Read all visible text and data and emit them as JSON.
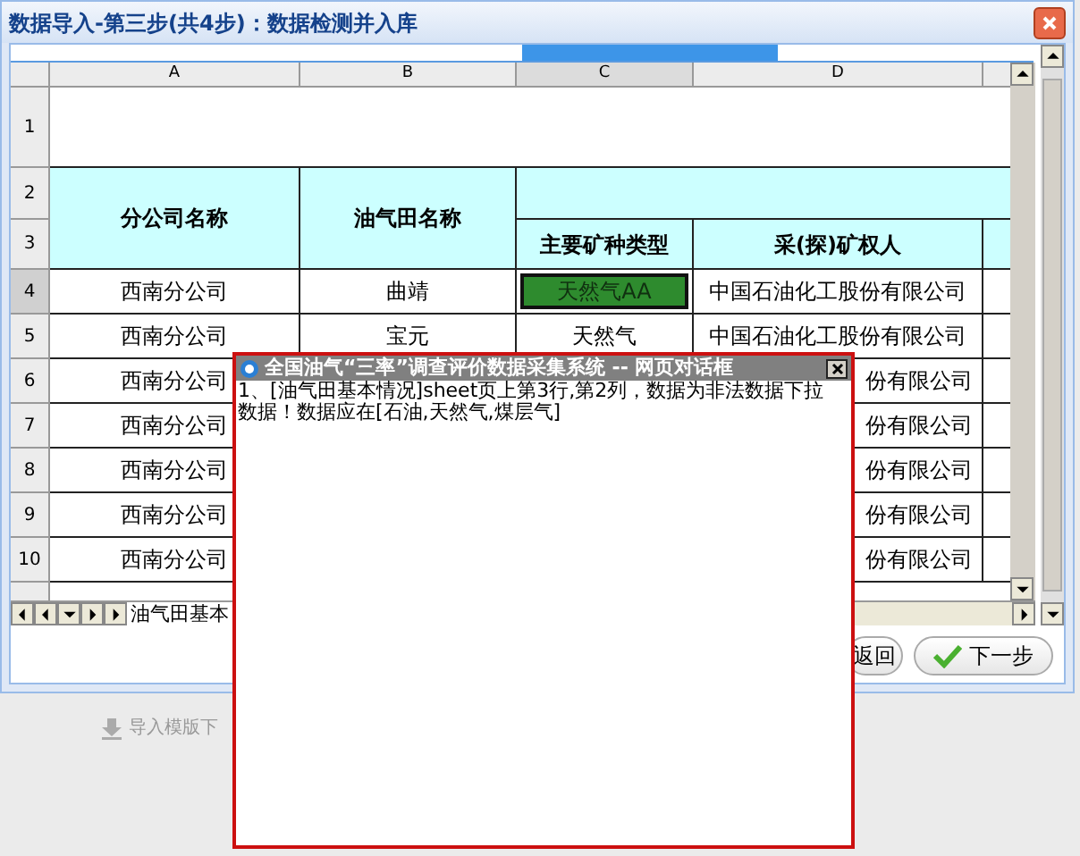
{
  "window": {
    "title": "数据导入-第三步(共4步)：数据检测并入库"
  },
  "steps": [
    {
      "selected": false
    },
    {
      "selected": false
    },
    {
      "selected": true
    },
    {
      "selected": false
    }
  ],
  "sheet": {
    "columns": [
      {
        "label": "A",
        "selected": false
      },
      {
        "label": "B",
        "selected": false
      },
      {
        "label": "C",
        "selected": true
      },
      {
        "label": "D",
        "selected": false
      }
    ],
    "title_row": {
      "number": "1",
      "selected": false
    },
    "header": {
      "numbers": [
        "2",
        "3"
      ],
      "company": "分公司名称",
      "field": "油气田名称",
      "mineral_type": "主要矿种类型",
      "owner": "采(探)矿权人"
    },
    "rows": [
      {
        "kind": "full",
        "number": "4",
        "selected": true,
        "cells": [
          {
            "text": "西南分公司",
            "flagged": false
          },
          {
            "text": "曲靖",
            "flagged": false
          },
          {
            "text": "天然气AA",
            "flagged": true
          },
          {
            "text": "中国石油化工股份有限公司",
            "flagged": false
          }
        ]
      },
      {
        "kind": "full",
        "number": "5",
        "selected": false,
        "cells": [
          {
            "text": "西南分公司",
            "flagged": false
          },
          {
            "text": "宝元",
            "flagged": false
          },
          {
            "text": "天然气",
            "flagged": false
          },
          {
            "text": "中国石油化工股份有限公司",
            "flagged": false
          }
        ]
      },
      {
        "kind": "covered",
        "number": "6",
        "selected": false,
        "company": "西南分公司",
        "owner_visible": "份有限公司"
      },
      {
        "kind": "covered",
        "number": "7",
        "selected": false,
        "company": "西南分公司",
        "owner_visible": "份有限公司"
      },
      {
        "kind": "covered",
        "number": "8",
        "selected": false,
        "company": "西南分公司",
        "owner_visible": "份有限公司"
      },
      {
        "kind": "covered",
        "number": "9",
        "selected": false,
        "company": "西南分公司",
        "owner_visible": "份有限公司"
      },
      {
        "kind": "covered",
        "number": "10",
        "selected": false,
        "company": "西南分公司",
        "owner_visible": "份有限公司"
      }
    ],
    "tabs": [
      {
        "label": "油气田基本",
        "selected": true
      }
    ]
  },
  "buttons": [
    {
      "kind": "back",
      "label": "返回"
    },
    {
      "kind": "next",
      "label": "下一步"
    }
  ],
  "download_link": "导入模版下",
  "dialog": {
    "title": "全国油气“三率”调查评价数据采集系统 -- 网页对话框",
    "message": "1、[油气田基本情况]sheet页上第3行,第2列，数据为非法数据下拉数据！数据应在[石油,天然气,煤层气]"
  }
}
